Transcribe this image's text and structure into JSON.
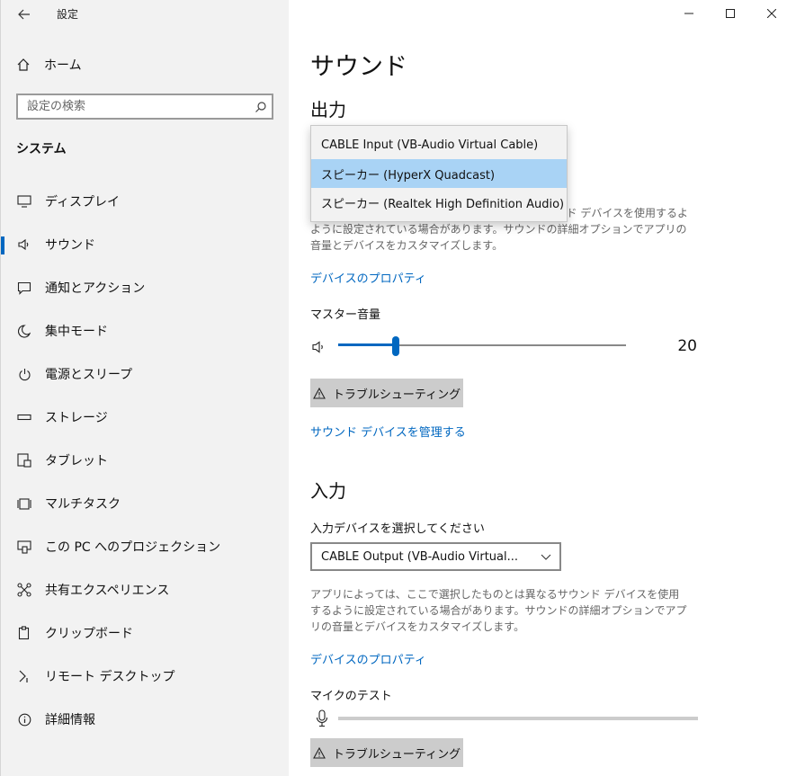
{
  "window": {
    "title": "設定",
    "back_icon": "arrow-left-icon",
    "controls": [
      "minimize-icon",
      "maximize-icon",
      "close-icon"
    ]
  },
  "sidebar": {
    "home_label": "ホーム",
    "search_placeholder": "設定の検索",
    "section_title": "システム",
    "items": [
      {
        "label": "ディスプレイ",
        "icon": "display-icon"
      },
      {
        "label": "サウンド",
        "icon": "speaker-icon",
        "active": true
      },
      {
        "label": "通知とアクション",
        "icon": "notification-icon"
      },
      {
        "label": "集中モード",
        "icon": "moon-icon"
      },
      {
        "label": "電源とスリープ",
        "icon": "power-icon"
      },
      {
        "label": "ストレージ",
        "icon": "storage-icon"
      },
      {
        "label": "タブレット",
        "icon": "tablet-icon"
      },
      {
        "label": "マルチタスク",
        "icon": "multitask-icon"
      },
      {
        "label": "この PC へのプロジェクション",
        "icon": "projection-icon"
      },
      {
        "label": "共有エクスペリエンス",
        "icon": "share-icon"
      },
      {
        "label": "クリップボード",
        "icon": "clipboard-icon"
      },
      {
        "label": "リモート デスクトップ",
        "icon": "remote-desktop-icon"
      },
      {
        "label": "詳細情報",
        "icon": "info-icon"
      }
    ]
  },
  "main": {
    "title": "サウンド",
    "output": {
      "heading": "出力",
      "description": "ように設定されている場合があります。サウンドの詳細オプションでアプリの音量とデバイスをカスタマイズします。",
      "description_partial": "ウンド デバイスを使用するよ",
      "device_properties_link": "デバイスのプロパティ",
      "master_volume_label": "マスター音量",
      "volume_value": "20",
      "volume_fraction": 0.2,
      "troubleshoot_label": "トラブルシューティング",
      "manage_devices_link": "サウンド デバイスを管理する",
      "dropdown_options": [
        "CABLE Input (VB-Audio Virtual Cable)",
        "スピーカー (HyperX Quadcast)",
        "スピーカー (Realtek High Definition Audio)"
      ],
      "dropdown_selected_index": 1
    },
    "input": {
      "heading": "入力",
      "select_label": "入力デバイスを選択してください",
      "selected_device": "CABLE Output (VB-Audio Virtual...",
      "description": "アプリによっては、ここで選択したものとは異なるサウンド デバイスを使用するように設定されている場合があります。サウンドの詳細オプションでアプリの音量とデバイスをカスタマイズします。",
      "device_properties_link": "デバイスのプロパティ",
      "mic_test_label": "マイクのテスト",
      "troubleshoot_label": "トラブルシューティング"
    }
  },
  "colors": {
    "accent": "#0067c0",
    "sidebar_bg": "#f2f2f2",
    "dropdown_selected": "#a9d3f5",
    "button_bg": "#cccccc"
  }
}
